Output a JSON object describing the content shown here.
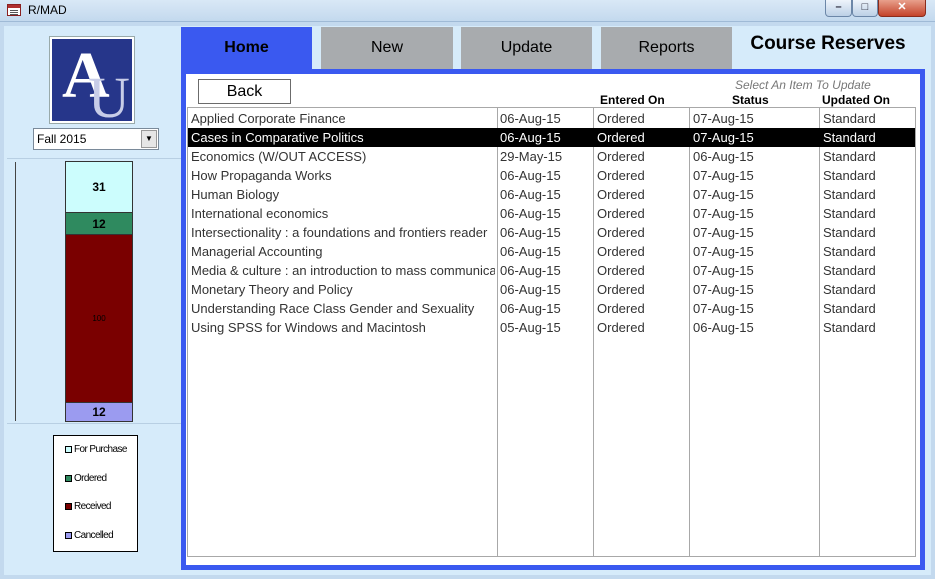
{
  "window": {
    "title": "R/MAD",
    "min_icon": "minimize-icon",
    "max_icon": "maximize-icon",
    "close_icon": "close-icon"
  },
  "sidebar": {
    "logo_letters": {
      "a": "A",
      "u": "U"
    },
    "term": {
      "selected": "Fall 2015"
    },
    "status_chart": {
      "segments": [
        {
          "key": "for_purchase",
          "label": "For Purchase",
          "value": "31",
          "color": "#ccfdfd"
        },
        {
          "key": "ordered",
          "label": "Ordered",
          "value": "12",
          "color": "#2f8a5f"
        },
        {
          "key": "received",
          "label": "Received",
          "value": "100",
          "color": "#7a0000"
        },
        {
          "key": "cancelled",
          "label": "Cancelled",
          "value": "12",
          "color": "#9b9bf0"
        }
      ]
    }
  },
  "tabs": [
    {
      "key": "home",
      "label": "Home",
      "active": true
    },
    {
      "key": "new",
      "label": "New",
      "active": false
    },
    {
      "key": "update",
      "label": "Update",
      "active": false
    },
    {
      "key": "reports",
      "label": "Reports",
      "active": false
    }
  ],
  "page_heading": "Course Reserves",
  "main": {
    "back_label": "Back",
    "hint": "Select An Item To Update",
    "columns": {
      "title": "",
      "date": "",
      "entered_on": "Entered On",
      "status": "Status",
      "updated_on": "Updated On"
    },
    "rows": [
      {
        "title": "Applied Corporate Finance",
        "date": "06-Aug-15",
        "entered_on": "Ordered",
        "status": "07-Aug-15",
        "updated_on": "Standard",
        "selected": false
      },
      {
        "title": "Cases in Comparative Politics",
        "date": "06-Aug-15",
        "entered_on": "Ordered",
        "status": "07-Aug-15",
        "updated_on": "Standard",
        "selected": true
      },
      {
        "title": "Economics (W/OUT ACCESS)",
        "date": "29-May-15",
        "entered_on": "Ordered",
        "status": "06-Aug-15",
        "updated_on": "Standard",
        "selected": false
      },
      {
        "title": "How Propaganda Works",
        "date": "06-Aug-15",
        "entered_on": "Ordered",
        "status": "07-Aug-15",
        "updated_on": "Standard",
        "selected": false
      },
      {
        "title": "Human Biology",
        "date": "06-Aug-15",
        "entered_on": "Ordered",
        "status": "07-Aug-15",
        "updated_on": "Standard",
        "selected": false
      },
      {
        "title": "International economics",
        "date": "06-Aug-15",
        "entered_on": "Ordered",
        "status": "07-Aug-15",
        "updated_on": "Standard",
        "selected": false
      },
      {
        "title": "Intersectionality : a foundations and frontiers reader",
        "date": "06-Aug-15",
        "entered_on": "Ordered",
        "status": "07-Aug-15",
        "updated_on": "Standard",
        "selected": false
      },
      {
        "title": "Managerial Accounting",
        "date": "06-Aug-15",
        "entered_on": "Ordered",
        "status": "07-Aug-15",
        "updated_on": "Standard",
        "selected": false
      },
      {
        "title": "Media & culture : an introduction to mass communication",
        "date": "06-Aug-15",
        "entered_on": "Ordered",
        "status": "07-Aug-15",
        "updated_on": "Standard",
        "selected": false
      },
      {
        "title": "Monetary Theory and Policy",
        "date": "06-Aug-15",
        "entered_on": "Ordered",
        "status": "07-Aug-15",
        "updated_on": "Standard",
        "selected": false
      },
      {
        "title": "Understanding Race Class Gender and Sexuality",
        "date": "06-Aug-15",
        "entered_on": "Ordered",
        "status": "07-Aug-15",
        "updated_on": "Standard",
        "selected": false
      },
      {
        "title": "Using SPSS for Windows and Macintosh",
        "date": "05-Aug-15",
        "entered_on": "Ordered",
        "status": "06-Aug-15",
        "updated_on": "Standard",
        "selected": false
      }
    ]
  }
}
